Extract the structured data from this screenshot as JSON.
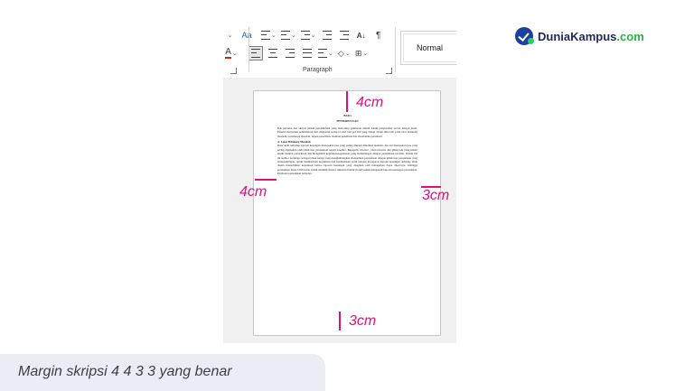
{
  "ribbon": {
    "group_label": "Paragraph",
    "style_preview": "Normal",
    "font_icons": [
      "change-case-icon",
      "font-color-icon"
    ],
    "paragraph_icons": [
      "bullets-icon",
      "numbering-icon",
      "multilevel-list-icon",
      "decrease-indent-icon",
      "increase-indent-icon",
      "sort-icon",
      "show-formatting-icon",
      "align-left-icon",
      "align-center-icon",
      "align-right-icon",
      "justify-icon",
      "line-spacing-icon",
      "shading-icon",
      "borders-icon"
    ],
    "sort_glyph": "A↓",
    "pilcrow": "¶",
    "font_glyph": "A",
    "case_glyph": "Aa"
  },
  "document": {
    "chapter": "BAB I",
    "chapter_title": "PENDAHULUAN",
    "intro": "Bab pertama dari skripsi adalah pendahuluan yang mencakup gambaran umum dalam penyusunan secara dengan jitetil. Penulis menyusun pembahasan dari ringkasan setiap isi dari bab per bab yang dibagi dalam lima bab yaitu latar belakang masalah, perumusan masalah, tujuan penelitian, manfaat penelitian dan sistematika penulisan.",
    "section_heading": "A. Latar Belakang Masalah",
    "body": "Dasa audit terhadap laporan keuangan merupakan jasa yang paling dikenal diberikan akuntan. Jasa ini merupakan jasa yang sering digunakan oleh pihak luar perusahaan seperti kreditor, Bapepam, investor, calon investor dan pihak lain yang terkait untuk menilai perusahaan dan mengambil keputusan-keputusan yang berhubungan dengan perusahaan tersebut. Dalam hal ini auditor berfungsi sebagai pihak ketiga yang menghubungkan manajemen perusahaan dengan pihak luar perusahaan yang berkepentingan, untuk memberikan keyakinan dan memberikan opini tentang kewajaran laporan keuangan terhadap iman dalam menerbitkan keputusan bahwa laporan keuangan yang disajikan oleh manajemen dapat dipercaya, sehingga perusahaan harus lebih kritis dalam memilih Kantor Akuntan Publik (KAP) untuk mengaudit laporan keuangan perusahaan. Penilaian perusahaan terhadap"
  },
  "margins": {
    "top": "4cm",
    "left": "4cm",
    "right": "3cm",
    "bottom": "3cm",
    "color": "#e0127a"
  },
  "logo": {
    "name": "DuniaKampus",
    "tld": ".com",
    "brand_color": "#1d3f9e",
    "tld_color": "#2bb14a"
  },
  "caption": "Margin skripsi 4 4 3 3 yang benar"
}
